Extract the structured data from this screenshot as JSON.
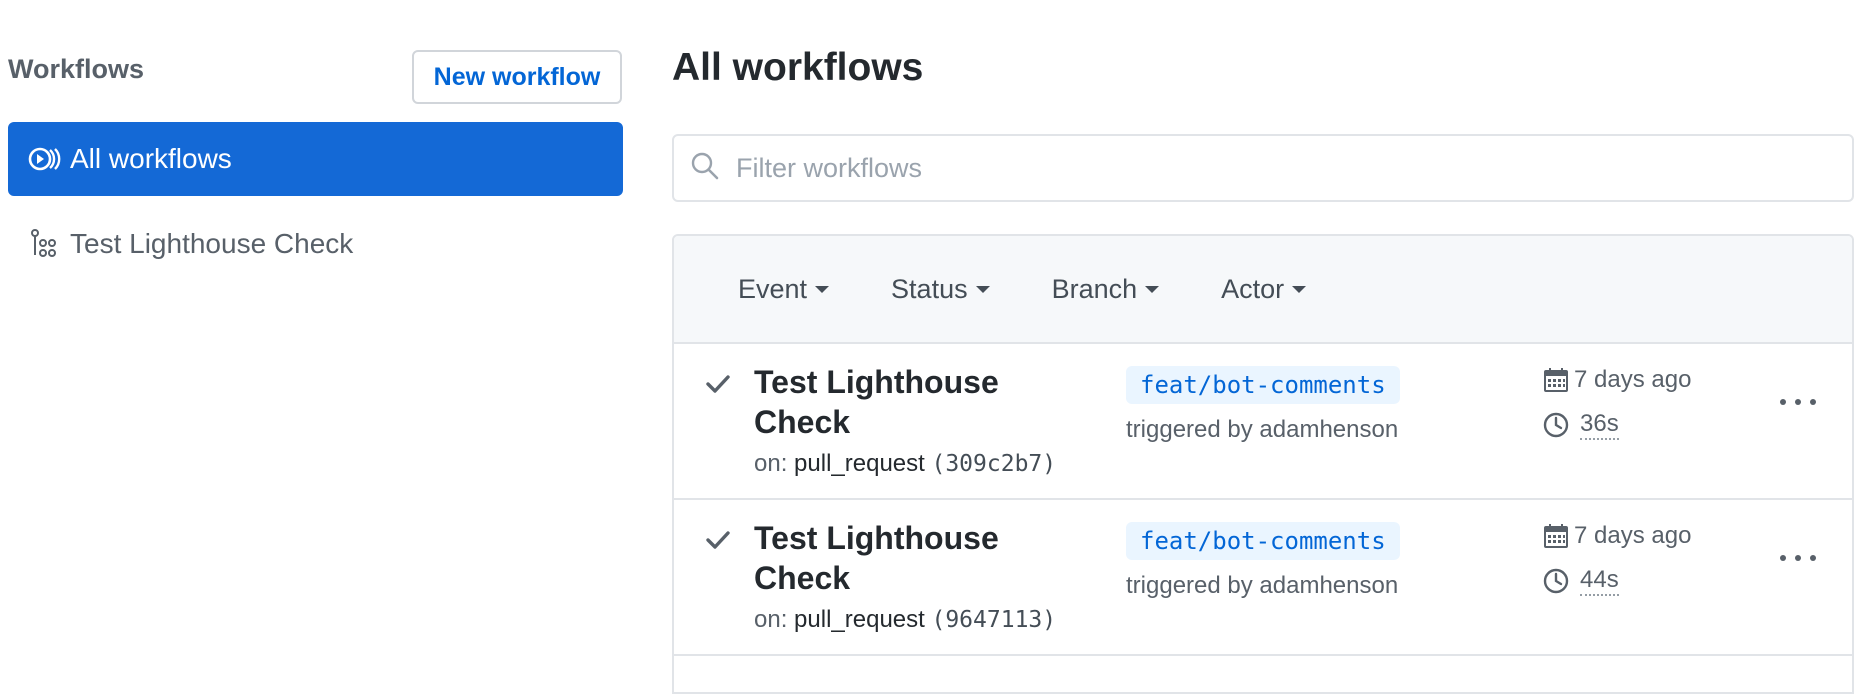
{
  "sidebar": {
    "title": "Workflows",
    "new_button_label": "New workflow",
    "items": [
      {
        "label": "All workflows",
        "icon": "play-circles-icon",
        "selected": true
      },
      {
        "label": "Test Lighthouse Check",
        "icon": "workflow-icon",
        "selected": false
      }
    ]
  },
  "main": {
    "title": "All workflows",
    "search": {
      "placeholder": "Filter workflows",
      "value": "",
      "icon": "search-icon"
    },
    "filters": [
      "Event",
      "Status",
      "Branch",
      "Actor"
    ],
    "runs": [
      {
        "title": "Test Lighthouse Check",
        "status": "success",
        "on_label": "on:",
        "event": "pull_request",
        "sha": "(309c2b7)",
        "branch": "feat/bot-comments",
        "triggered_by": "triggered by adamhenson",
        "date": "7 days ago",
        "duration": "36s"
      },
      {
        "title": "Test Lighthouse Check",
        "status": "success",
        "on_label": "on:",
        "event": "pull_request",
        "sha": "(9647113)",
        "branch": "feat/bot-comments",
        "triggered_by": "triggered by adamhenson",
        "date": "7 days ago",
        "duration": "44s"
      }
    ]
  },
  "colors": {
    "accent": "#1469d6",
    "link": "#0366d6",
    "muted": "#586069",
    "border": "#e1e4e8",
    "branch_bg": "#eaf5ff"
  }
}
